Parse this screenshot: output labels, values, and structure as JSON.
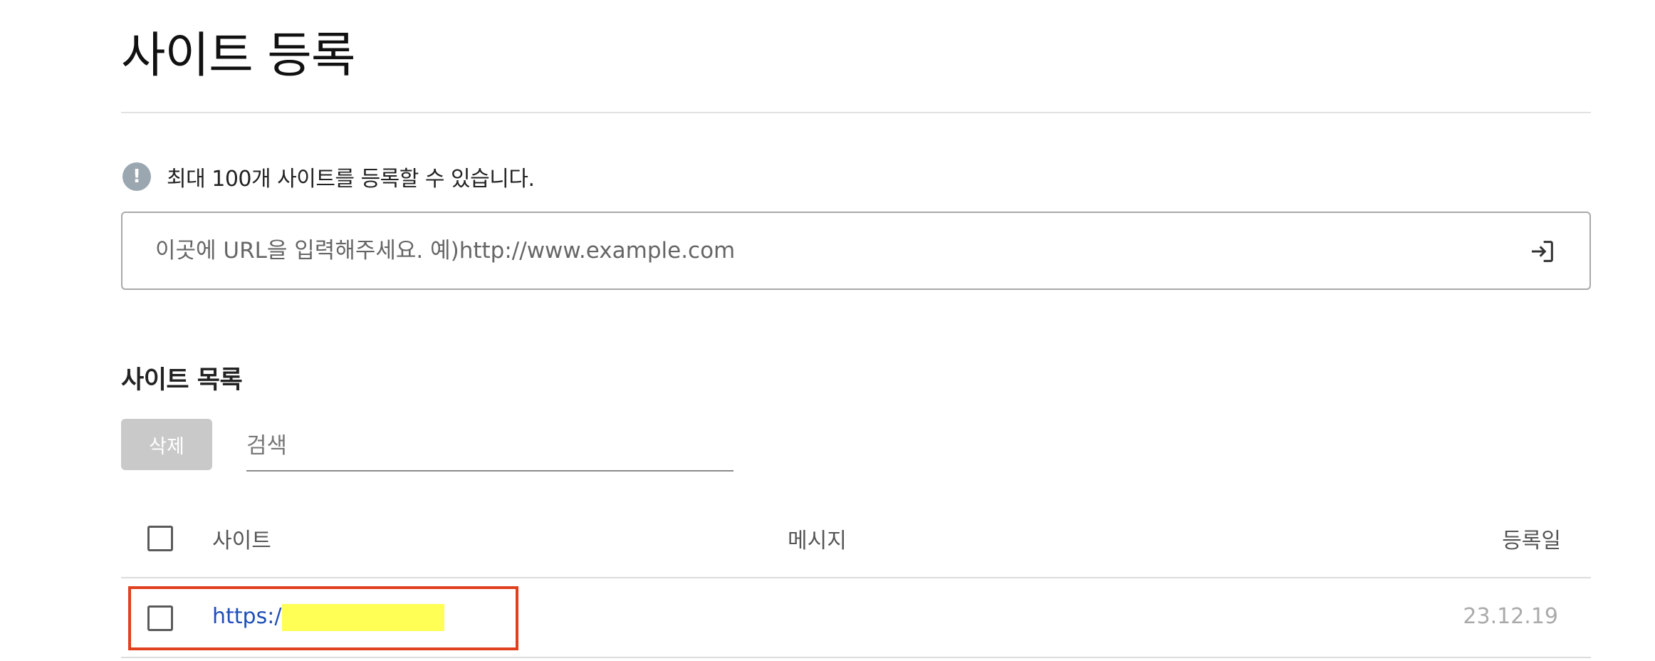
{
  "header": {
    "title": "사이트 등록"
  },
  "notice": {
    "icon": "exclamation-icon",
    "icon_glyph": "!",
    "text": "최대 100개 사이트를 등록할 수 있습니다."
  },
  "url_input": {
    "placeholder": "이곳에 URL을 입력해주세요. 예)http://www.example.com",
    "value": "",
    "submit_icon": "enter-arrow-icon"
  },
  "site_list": {
    "title": "사이트 목록",
    "delete_label": "삭제",
    "search_placeholder": "검색",
    "columns": {
      "site": "사이트",
      "message": "메시지",
      "date": "등록일"
    },
    "rows": [
      {
        "site": "https:/",
        "message": "",
        "date": "23.12.19",
        "checked": false
      }
    ]
  },
  "colors": {
    "link": "#1f4fb8",
    "highlight": "#e0401e",
    "redaction": "#ffff55",
    "delete_button": "#c9c9c9",
    "notice_icon": "#9aa6b0"
  }
}
